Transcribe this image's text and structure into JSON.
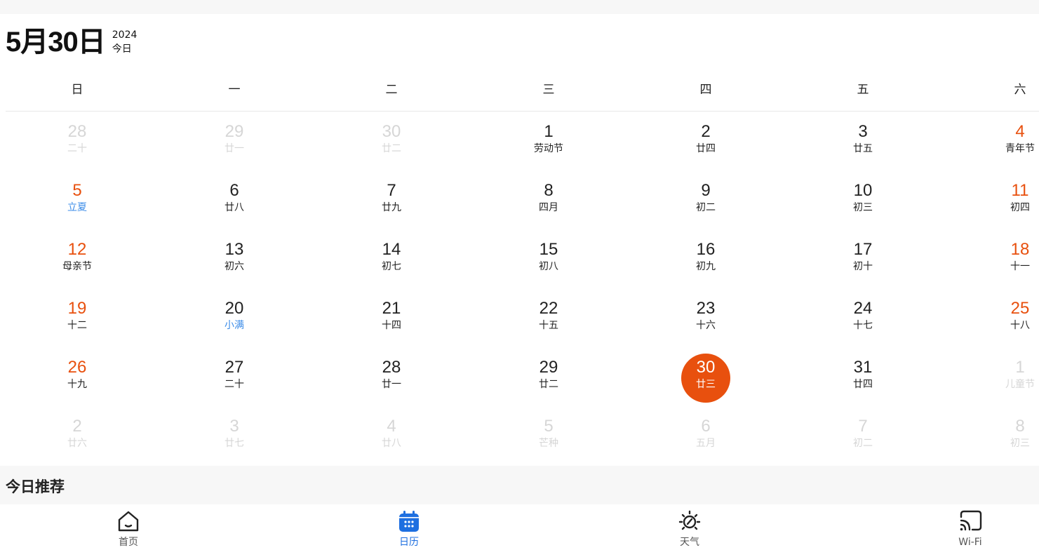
{
  "header": {
    "date": "5月30日",
    "year": "2024",
    "today_label": "今日"
  },
  "weekdays": [
    "日",
    "一",
    "二",
    "三",
    "四",
    "五",
    "六"
  ],
  "weeks": [
    [
      {
        "num": "28",
        "sub": "二十",
        "state": "dim"
      },
      {
        "num": "29",
        "sub": "廿一",
        "state": "dim"
      },
      {
        "num": "30",
        "sub": "廿二",
        "state": "dim"
      },
      {
        "num": "1",
        "sub": "劳动节",
        "state": ""
      },
      {
        "num": "2",
        "sub": "廿四",
        "state": ""
      },
      {
        "num": "3",
        "sub": "廿五",
        "state": ""
      },
      {
        "num": "4",
        "sub": "青年节",
        "state": "weekend"
      }
    ],
    [
      {
        "num": "5",
        "sub": "立夏",
        "state": "weekend term"
      },
      {
        "num": "6",
        "sub": "廿八",
        "state": ""
      },
      {
        "num": "7",
        "sub": "廿九",
        "state": ""
      },
      {
        "num": "8",
        "sub": "四月",
        "state": ""
      },
      {
        "num": "9",
        "sub": "初二",
        "state": ""
      },
      {
        "num": "10",
        "sub": "初三",
        "state": ""
      },
      {
        "num": "11",
        "sub": "初四",
        "state": "weekend"
      }
    ],
    [
      {
        "num": "12",
        "sub": "母亲节",
        "state": "weekend"
      },
      {
        "num": "13",
        "sub": "初六",
        "state": ""
      },
      {
        "num": "14",
        "sub": "初七",
        "state": ""
      },
      {
        "num": "15",
        "sub": "初八",
        "state": ""
      },
      {
        "num": "16",
        "sub": "初九",
        "state": ""
      },
      {
        "num": "17",
        "sub": "初十",
        "state": ""
      },
      {
        "num": "18",
        "sub": "十一",
        "state": "weekend"
      }
    ],
    [
      {
        "num": "19",
        "sub": "十二",
        "state": "weekend"
      },
      {
        "num": "20",
        "sub": "小满",
        "state": "term"
      },
      {
        "num": "21",
        "sub": "十四",
        "state": ""
      },
      {
        "num": "22",
        "sub": "十五",
        "state": ""
      },
      {
        "num": "23",
        "sub": "十六",
        "state": ""
      },
      {
        "num": "24",
        "sub": "十七",
        "state": ""
      },
      {
        "num": "25",
        "sub": "十八",
        "state": "weekend"
      }
    ],
    [
      {
        "num": "26",
        "sub": "十九",
        "state": "weekend"
      },
      {
        "num": "27",
        "sub": "二十",
        "state": ""
      },
      {
        "num": "28",
        "sub": "廿一",
        "state": ""
      },
      {
        "num": "29",
        "sub": "廿二",
        "state": ""
      },
      {
        "num": "30",
        "sub": "廿三",
        "state": "today"
      },
      {
        "num": "31",
        "sub": "廿四",
        "state": ""
      },
      {
        "num": "1",
        "sub": "儿童节",
        "state": "dim"
      }
    ],
    [
      {
        "num": "2",
        "sub": "廿六",
        "state": "dim"
      },
      {
        "num": "3",
        "sub": "廿七",
        "state": "dim"
      },
      {
        "num": "4",
        "sub": "廿八",
        "state": "dim"
      },
      {
        "num": "5",
        "sub": "芒种",
        "state": "dim"
      },
      {
        "num": "6",
        "sub": "五月",
        "state": "dim"
      },
      {
        "num": "7",
        "sub": "初二",
        "state": "dim"
      },
      {
        "num": "8",
        "sub": "初三",
        "state": "dim"
      }
    ]
  ],
  "section": {
    "title": "今日推荐"
  },
  "tabs": [
    {
      "label": "首页",
      "icon": "home-icon",
      "active": false
    },
    {
      "label": "日历",
      "icon": "calendar-icon",
      "active": true
    },
    {
      "label": "天气",
      "icon": "weather-icon",
      "active": false
    },
    {
      "label": "Wi-Fi",
      "icon": "cast-icon",
      "active": false
    }
  ],
  "colors": {
    "accent": "#e8500e",
    "weekend": "#e8500e",
    "solar_term": "#3a8be8",
    "active_tab": "#1e6fe0",
    "dim": "#d6d6d6"
  }
}
